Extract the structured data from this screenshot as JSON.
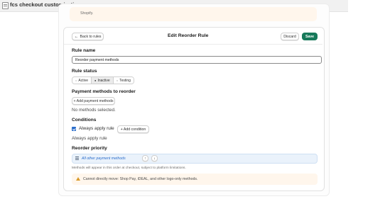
{
  "app": {
    "title": "fcs checkout customization",
    "icon": "app-window-icon"
  },
  "top_notice": {
    "text": "Shopify."
  },
  "header": {
    "back_label": "Back to rules",
    "title": "Edit Reorder Rule",
    "discard_label": "Discard",
    "save_label": "Save"
  },
  "rule_name": {
    "label": "Rule name",
    "value": "Reorder payment methods"
  },
  "rule_status": {
    "label": "Rule status",
    "options": [
      "Active",
      "Inactive",
      "Testing"
    ],
    "selected": "Inactive"
  },
  "payment_methods": {
    "label": "Payment methods to reorder",
    "add_label": "+ Add payment methods",
    "empty_text": "No methods selected."
  },
  "conditions": {
    "label": "Conditions",
    "always_apply_label": "Always apply rule",
    "always_apply_checked": true,
    "add_label": "+ Add condition",
    "summary": "Always apply rule"
  },
  "reorder_priority": {
    "label": "Reorder priority",
    "items": [
      "All other payment methods"
    ],
    "up_glyph": "↑",
    "down_glyph": "↓",
    "help": "Methods will appear in this order at checkout, subject to platform limitations.",
    "warning": "Cannot directly move: Shop Pay, iDEAL, and other logo-only methods."
  },
  "colors": {
    "primary": "#17795a",
    "accent": "#2c6ecb",
    "warning_bg": "#fff6ec",
    "warning_icon": "#d99b2b"
  }
}
